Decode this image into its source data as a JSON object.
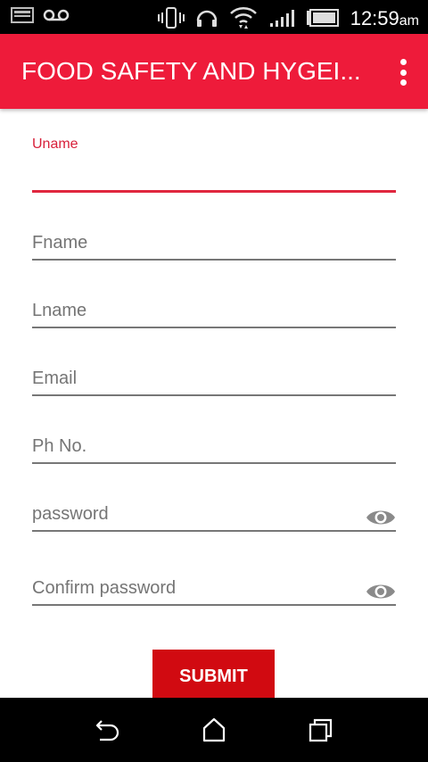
{
  "status_bar": {
    "time": "12:59",
    "ampm": "am",
    "icons": [
      "sim-card-icon",
      "voicemail-icon",
      "vibrate-icon",
      "headset-icon",
      "wifi-icon",
      "signal-icon",
      "battery-icon"
    ]
  },
  "app_bar": {
    "title": "FOOD SAFETY AND HYGEI...",
    "background": "#ee1b3a",
    "overflow_icon": "more-vert-icon"
  },
  "form": {
    "uname": {
      "label": "Uname",
      "value": ""
    },
    "fname": {
      "placeholder": "Fname"
    },
    "lname": {
      "placeholder": "Lname"
    },
    "email": {
      "placeholder": "Email"
    },
    "phone": {
      "placeholder": "Ph No."
    },
    "password": {
      "placeholder": "password",
      "toggle_icon": "eye-icon"
    },
    "confirm_password": {
      "placeholder": "Confirm password",
      "toggle_icon": "eye-icon"
    }
  },
  "submit": {
    "label": "SUBMIT",
    "color": "#d10a11"
  },
  "nav_bar": {
    "icons": [
      "back-icon",
      "home-icon",
      "recents-icon"
    ]
  }
}
